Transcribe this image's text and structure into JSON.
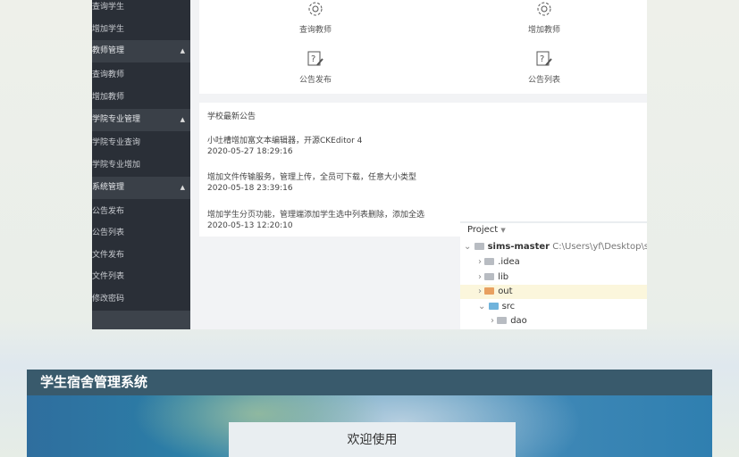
{
  "sidebar": {
    "items": [
      {
        "label": "查询学生",
        "type": "item"
      },
      {
        "label": "增加学生",
        "type": "item"
      },
      {
        "label": "教师管理",
        "type": "group"
      },
      {
        "label": "查询教师",
        "type": "item"
      },
      {
        "label": "增加教师",
        "type": "item"
      },
      {
        "label": "学院专业管理",
        "type": "group"
      },
      {
        "label": "学院专业查询",
        "type": "item"
      },
      {
        "label": "学院专业增加",
        "type": "item"
      },
      {
        "label": "系统管理",
        "type": "group"
      },
      {
        "label": "公告发布",
        "type": "item"
      },
      {
        "label": "公告列表",
        "type": "item"
      },
      {
        "label": "文件发布",
        "type": "item"
      },
      {
        "label": "文件列表",
        "type": "item"
      },
      {
        "label": "修改密码",
        "type": "item"
      }
    ],
    "caret": "▲"
  },
  "tiles": [
    {
      "label": "查询教师",
      "icon": "gear-icon"
    },
    {
      "label": "增加教师",
      "icon": "gear-icon"
    },
    {
      "label": "公告发布",
      "icon": "help-edit-icon"
    },
    {
      "label": "公告列表",
      "icon": "help-edit-icon"
    }
  ],
  "notices": {
    "title": "学校最新公告",
    "items": [
      {
        "text": "小吐槽增加富文本编辑器，开源CKEditor 4",
        "time": "2020-05-27 18:29:16"
      },
      {
        "text": "增加文件传输服务，管理上传，全员可下载，任意大小类型",
        "time": "2020-05-18 23:39:16"
      },
      {
        "text": "增加学生分页功能，管理端添加学生选中列表删除，添加全选",
        "time": "2020-05-13 12:20:10"
      }
    ]
  },
  "project": {
    "title": "Project",
    "root": "sims-master",
    "root_path": "C:\\Users\\yf\\Desktop\\sin",
    "nodes": [
      {
        "name": ".idea",
        "color": "#b8bcc2"
      },
      {
        "name": "lib",
        "color": "#b8bcc2"
      },
      {
        "name": "out",
        "color": "#e8a060"
      },
      {
        "name": "src",
        "color": "#6fb3dc"
      },
      {
        "name": "dao",
        "color": "#b8bcc2"
      }
    ]
  },
  "login": {
    "system_title": "学生宿舍管理系统",
    "welcome": "欢迎使用"
  }
}
